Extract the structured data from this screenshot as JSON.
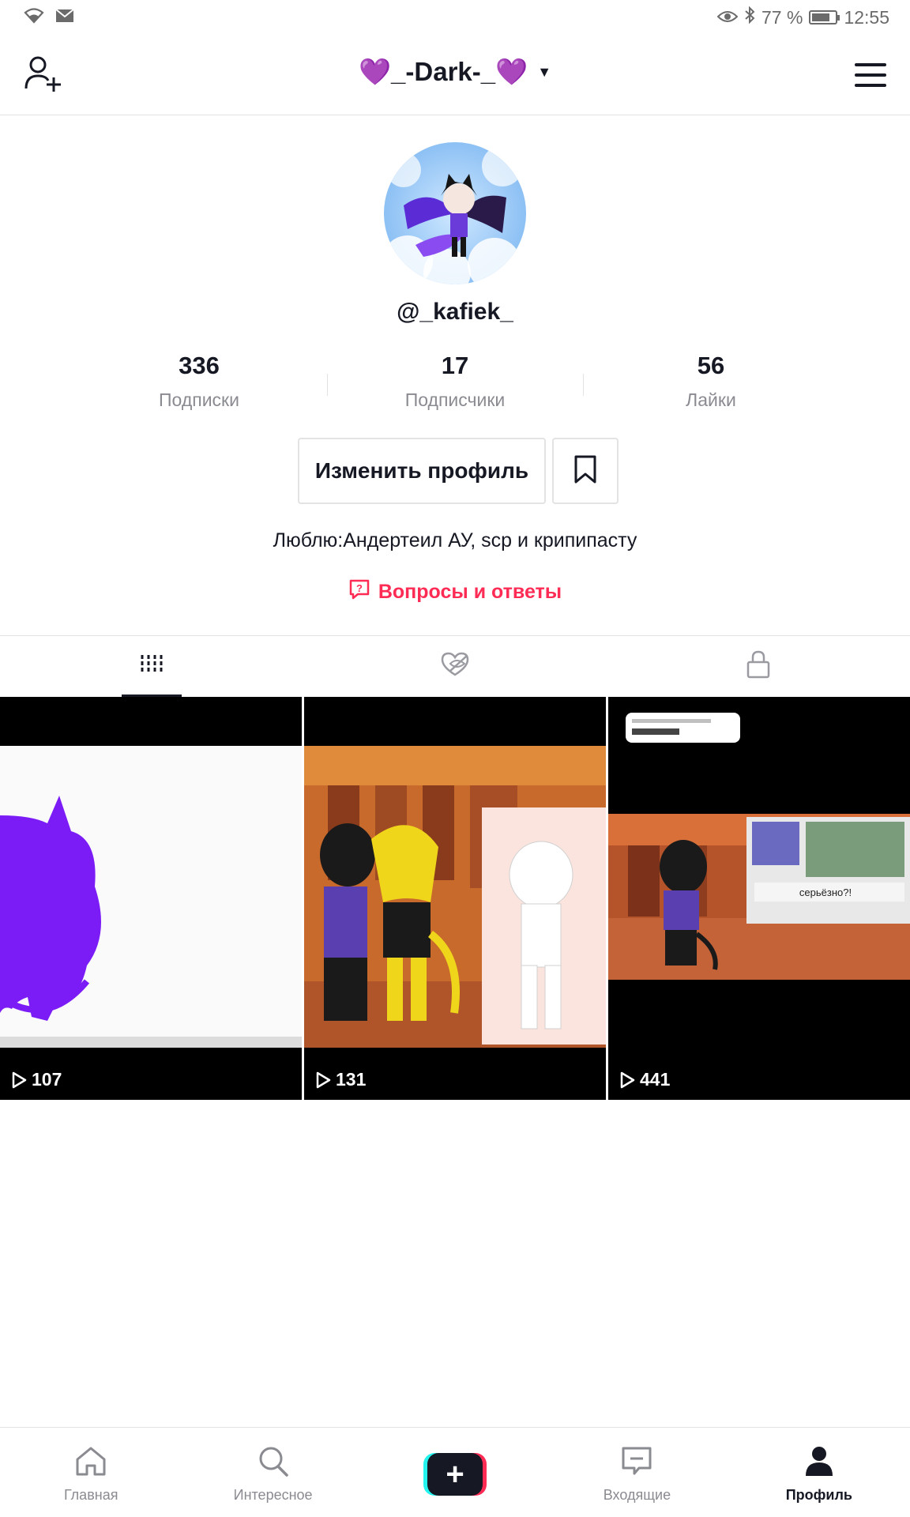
{
  "status_bar": {
    "battery": "77 %",
    "time": "12:55",
    "battery_level": 0.77
  },
  "header": {
    "title": "💜_-Dark-_💜",
    "icons": [
      "add-user-icon",
      "caret-down-icon",
      "hamburger-menu-icon"
    ]
  },
  "profile": {
    "username": "@_kafiek_",
    "stats": [
      {
        "value": "336",
        "label": "Подписки"
      },
      {
        "value": "17",
        "label": "Подписчики"
      },
      {
        "value": "56",
        "label": "Лайки"
      }
    ],
    "edit_label": "Изменить профиль",
    "bio": "Люблю:Андертеил АУ, scp и крипипасту",
    "qa_label": "Вопросы и ответы"
  },
  "tabs": [
    {
      "icon": "videos-grid-icon",
      "active": true
    },
    {
      "icon": "liked-hidden-icon",
      "active": false
    },
    {
      "icon": "private-lock-icon",
      "active": false
    }
  ],
  "videos": [
    {
      "views": "107"
    },
    {
      "views": "131"
    },
    {
      "views": "441",
      "caption": "серьёзно?!"
    }
  ],
  "bottom_nav": [
    {
      "label": "Главная",
      "icon": "home-icon"
    },
    {
      "label": "Интересное",
      "icon": "search-icon"
    },
    {
      "label": "",
      "icon": "plus-icon"
    },
    {
      "label": "Входящие",
      "icon": "inbox-icon"
    },
    {
      "label": "Профиль",
      "icon": "profile-icon",
      "active": true
    }
  ],
  "colors": {
    "accent": "#fe2c55",
    "text": "#161823",
    "muted": "#8a8b91",
    "border": "#e3e3e4"
  }
}
